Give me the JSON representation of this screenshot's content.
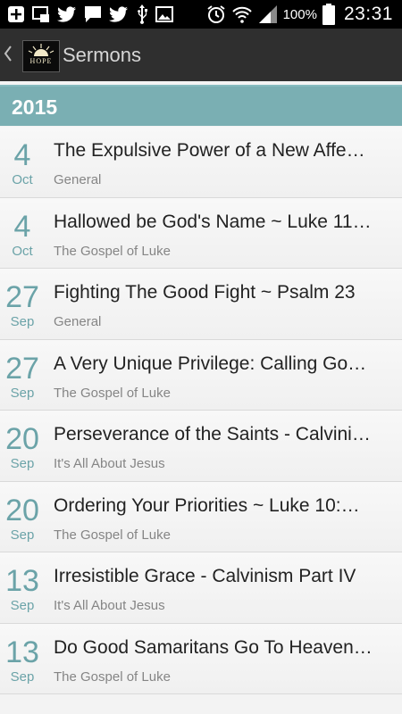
{
  "status_bar": {
    "icons": [
      "add-icon",
      "picture-in-picture-icon",
      "twitter-icon",
      "chat-icon",
      "twitter-icon",
      "usb-icon",
      "image-icon"
    ],
    "right_icons": [
      "alarm-icon",
      "wifi-icon",
      "signal-icon",
      "battery-icon"
    ],
    "battery_percent": "100%",
    "time": "23:31"
  },
  "action_bar": {
    "logo_text": "HOPE",
    "title": "Sermons"
  },
  "section": {
    "year": "2015"
  },
  "sermons": [
    {
      "day": "4",
      "month": "Oct",
      "title": "The Expulsive Power of a New Affe…",
      "category": "General"
    },
    {
      "day": "4",
      "month": "Oct",
      "title": "Hallowed be God's Name ~ Luke 11…",
      "category": "The Gospel of Luke"
    },
    {
      "day": "27",
      "month": "Sep",
      "title": "Fighting The Good Fight ~ Psalm 23",
      "category": "General"
    },
    {
      "day": "27",
      "month": "Sep",
      "title": "A Very Unique Privilege: Calling Go…",
      "category": "The Gospel of Luke"
    },
    {
      "day": "20",
      "month": "Sep",
      "title": "Perseverance of the Saints - Calvini…",
      "category": "It's All About Jesus"
    },
    {
      "day": "20",
      "month": "Sep",
      "title": "Ordering Your Priorities ~ Luke 10:…",
      "category": "The Gospel of Luke"
    },
    {
      "day": "13",
      "month": "Sep",
      "title": "Irresistible Grace  - Calvinism Part IV",
      "category": "It's All About Jesus"
    },
    {
      "day": "13",
      "month": "Sep",
      "title": "Do Good Samaritans Go To Heaven…",
      "category": "The Gospel of Luke"
    }
  ],
  "colors": {
    "accent": "#6ba3a8",
    "section_header": "#7aafb3",
    "action_bar": "#2f2f2f"
  }
}
